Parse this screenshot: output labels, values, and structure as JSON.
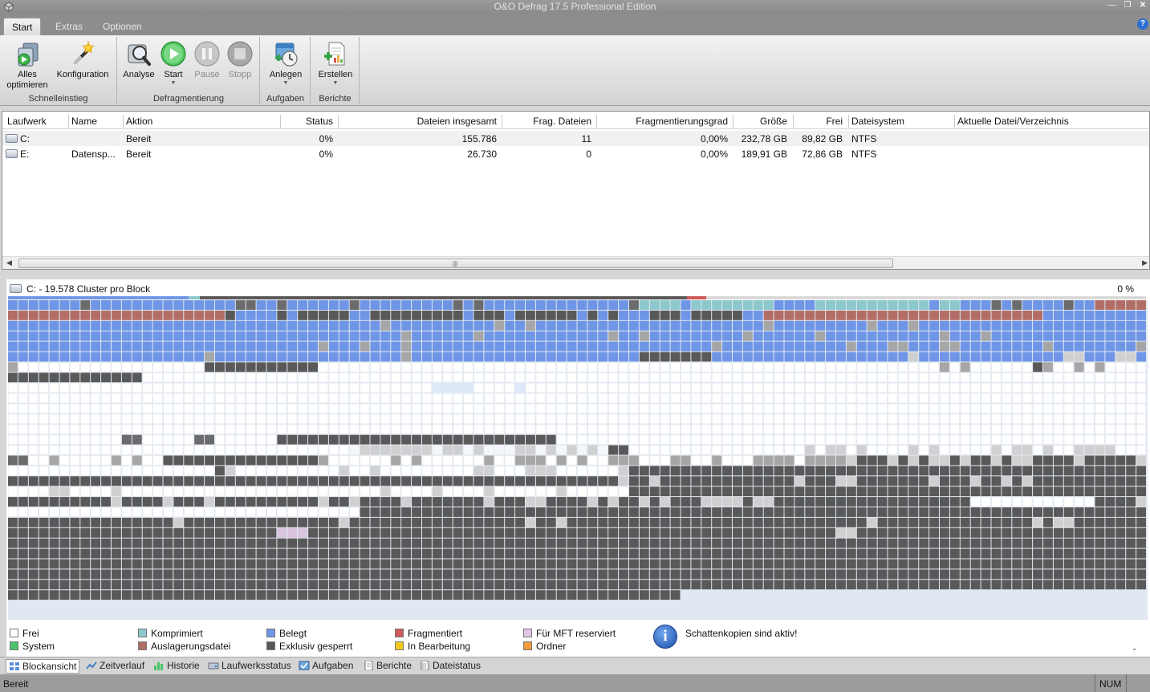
{
  "window": {
    "title": "O&O Defrag 17.5 Professional Edition"
  },
  "ribbon_tabs": [
    "Start",
    "Extras",
    "Optionen"
  ],
  "ribbon": {
    "groups": {
      "schnell": {
        "label": "Schnelleinstieg",
        "b1": "Alles\noptimieren",
        "b2": "Konfiguration"
      },
      "defrag": {
        "label": "Defragmentierung",
        "b1": "Analyse",
        "b2": "Start",
        "b3": "Pause",
        "b4": "Stopp"
      },
      "aufgaben": {
        "label": "Aufgaben",
        "b1": "Anlegen"
      },
      "berichte": {
        "label": "Berichte",
        "b1": "Erstellen"
      }
    }
  },
  "drive_table": {
    "headers": [
      "Laufwerk",
      "Name",
      "Aktion",
      "Status",
      "Dateien insgesamt",
      "Frag. Dateien",
      "Fragmentierungsgrad",
      "Größe",
      "Frei",
      "Dateisystem",
      "Aktuelle Datei/Verzeichnis"
    ],
    "rows": [
      [
        "C:",
        "",
        "Bereit",
        "0%",
        "155.786",
        "11",
        "0,00%",
        "232,78 GB",
        "89,82 GB",
        "NTFS",
        ""
      ],
      [
        "E:",
        "Datensp...",
        "Bereit",
        "0%",
        "26.730",
        "0",
        "0,00%",
        "189,91 GB",
        "72,86 GB",
        "NTFS",
        ""
      ]
    ]
  },
  "block_view": {
    "title": "C: - 19.578 Cluster pro Block",
    "percent": "0 %"
  },
  "legend": {
    "items": [
      "Frei",
      "System",
      "Komprimiert",
      "Auslagerungsdatei",
      "Belegt",
      "Exklusiv gesperrt",
      "Fragmentiert",
      "In Bearbeitung",
      "Für MFT reserviert",
      "Ordner"
    ],
    "colors": {
      "frei": "#ffffff",
      "system": "#4cc36a",
      "komprimiert": "#8cc8cc",
      "auslagerung": "#b26e66",
      "belegt": "#6f95e6",
      "exklusiv": "#595959",
      "fragmentiert": "#d05a5a",
      "bearbeitung": "#f2c81e",
      "mft": "#e0c6e4",
      "ordner": "#f39a3a"
    },
    "info": "Schattenkopien sind aktiv!"
  },
  "view_tabs": [
    "Blockansicht",
    "Zeitverlauf",
    "Historie",
    "Laufwerksstatus",
    "Aufgaben",
    "Berichte",
    "Dateistatus"
  ],
  "status": {
    "left": "Bereit",
    "num": "NUM"
  }
}
